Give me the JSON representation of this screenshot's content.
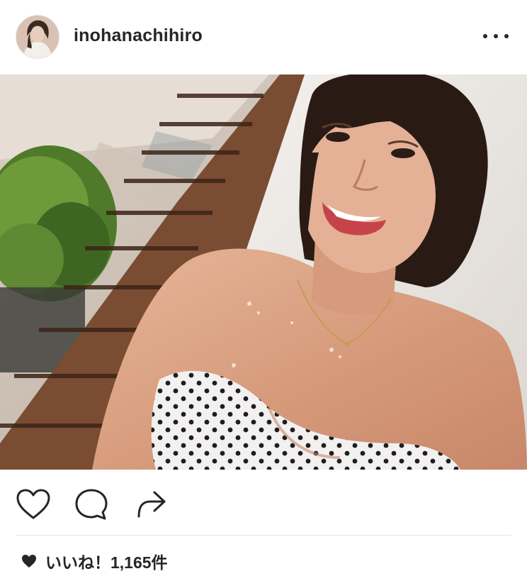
{
  "post": {
    "username": "inohanachihiro",
    "likes_text": "いいね！1,165件"
  },
  "icons": {
    "avatar": "profile-photo",
    "more": "more-dots-icon",
    "like": "heart-outline-icon",
    "comment": "comment-bubble-icon",
    "share": "share-arrow-icon",
    "likes_heart": "heart-filled-icon"
  },
  "colors": {
    "text": "#262626",
    "divider": "#e6e6e6",
    "background": "#ffffff"
  }
}
